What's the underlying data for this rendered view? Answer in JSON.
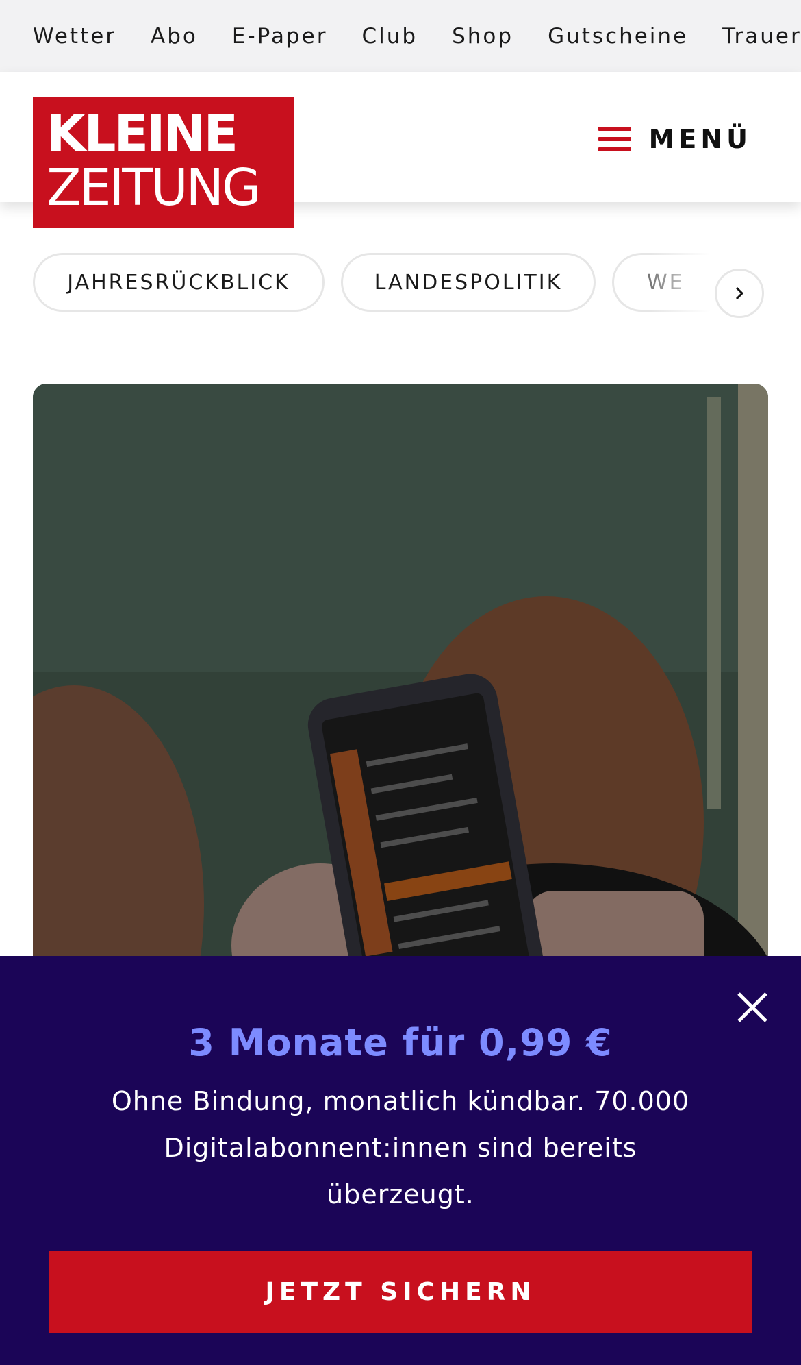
{
  "topbar": {
    "links": [
      "Wetter",
      "Abo",
      "E-Paper",
      "Club",
      "Shop",
      "Gutscheine",
      "Trauerportal"
    ]
  },
  "header": {
    "logo_line1": "KLEINE",
    "logo_line2": "ZEITUNG",
    "menu_label": "MENÜ",
    "brand_color": "#c8101e"
  },
  "chips": {
    "items": [
      "JAHRESRÜCKBLICK",
      "LANDESPOLITIK",
      "WE"
    ]
  },
  "paywall": {
    "offer": "3 Monate für 0,99 €",
    "desc": "Ohne Bindung, monatlich kündbar. 70.000 Digitalabonnent:innen sind bereits überzeugt.",
    "cta_label": "JETZT SICHERN",
    "background": "#1b0557",
    "accent": "#7d8bff"
  }
}
